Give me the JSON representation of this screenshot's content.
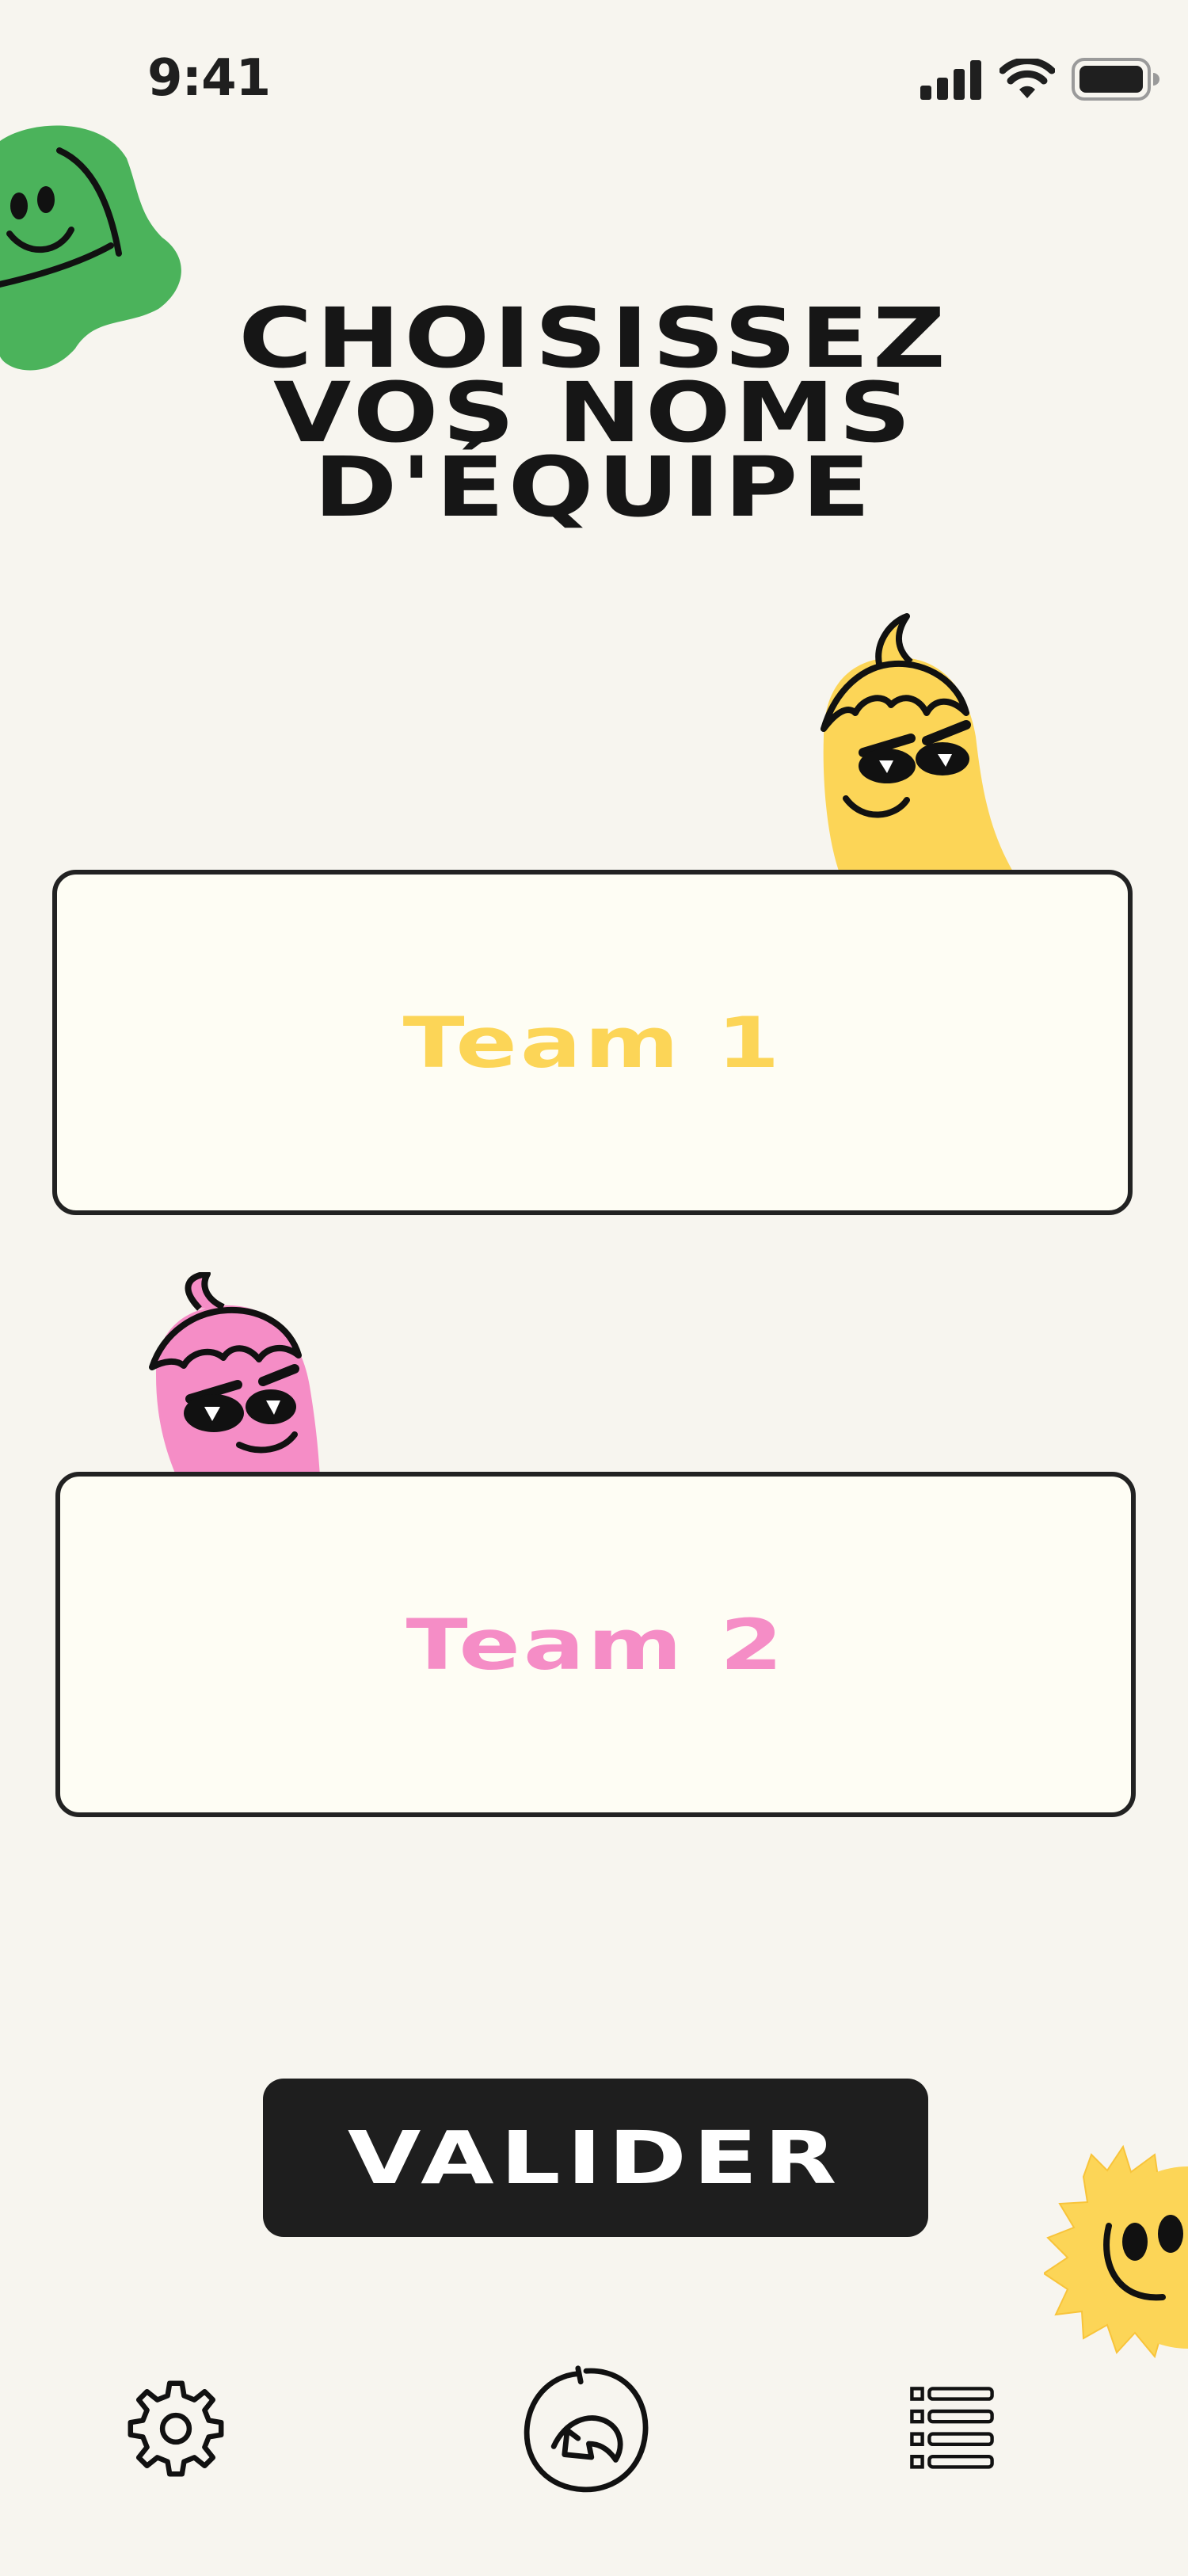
{
  "status_bar": {
    "time": "9:41",
    "icons": [
      "signal-icon",
      "wifi-icon",
      "battery-icon"
    ]
  },
  "title": {
    "lines": [
      "CHOISISSEZ",
      "VOS NOMS",
      "D'ÉQUIPE"
    ]
  },
  "teams": [
    {
      "placeholder": "Team 1",
      "color": "#fcd557",
      "mascot": "yellow-mascot"
    },
    {
      "placeholder": "Team 2",
      "color": "#f58dc6",
      "mascot": "pink-mascot"
    }
  ],
  "validate_button": {
    "label": "VALIDER"
  },
  "bottom_nav": {
    "items": [
      {
        "icon": "gear-icon"
      },
      {
        "icon": "undo-icon"
      },
      {
        "icon": "list-icon"
      }
    ]
  },
  "colors": {
    "background": "#f7f5ef",
    "card_background": "#fefdf4",
    "accent_green": "#4bb35b",
    "accent_yellow": "#fcd557",
    "accent_pink": "#f58dc6",
    "dark": "#1e1e1e"
  }
}
